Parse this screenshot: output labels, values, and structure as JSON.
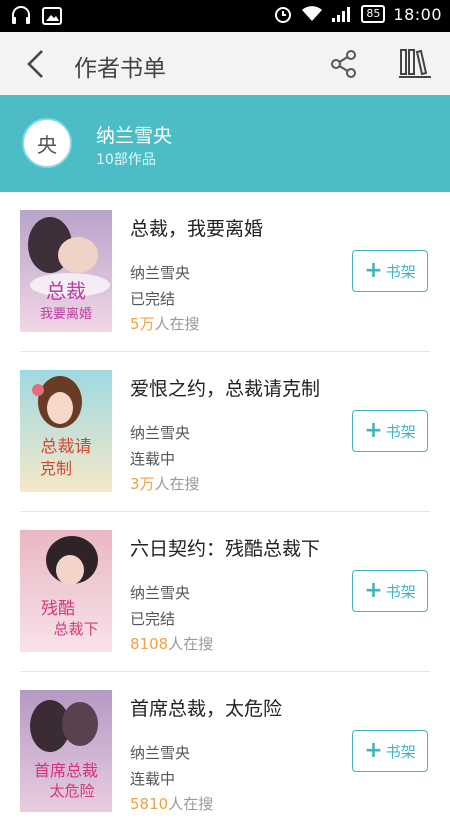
{
  "status_bar": {
    "time": "18:00",
    "battery": "85"
  },
  "toolbar": {
    "title": "作者书单"
  },
  "author": {
    "avatar_char": "央",
    "name": "纳兰雪央",
    "works": "10部作品"
  },
  "books": [
    {
      "title": "总裁，我要离婚",
      "author": "纳兰雪央",
      "status": "已完结",
      "search_num": "5万",
      "search_suffix": "人在搜",
      "button": "书架",
      "cover_text1": "总裁",
      "cover_text2": "我要离婚"
    },
    {
      "title": "爱恨之约，总裁请克制",
      "author": "纳兰雪央",
      "status": "连载中",
      "search_num": "3万",
      "search_suffix": "人在搜",
      "button": "书架",
      "cover_text1": "总裁请",
      "cover_text2": "克制"
    },
    {
      "title": "六日契约：残酷总裁下",
      "author": "纳兰雪央",
      "status": "已完结",
      "search_num": "8108",
      "search_suffix": "人在搜",
      "button": "书架",
      "cover_text1": "残酷",
      "cover_text2": "总裁下"
    },
    {
      "title": "首席总裁，太危险",
      "author": "纳兰雪央",
      "status": "连载中",
      "search_num": "5810",
      "search_suffix": "人在搜",
      "button": "书架",
      "cover_text1": "首席总裁",
      "cover_text2": "太危险"
    }
  ]
}
